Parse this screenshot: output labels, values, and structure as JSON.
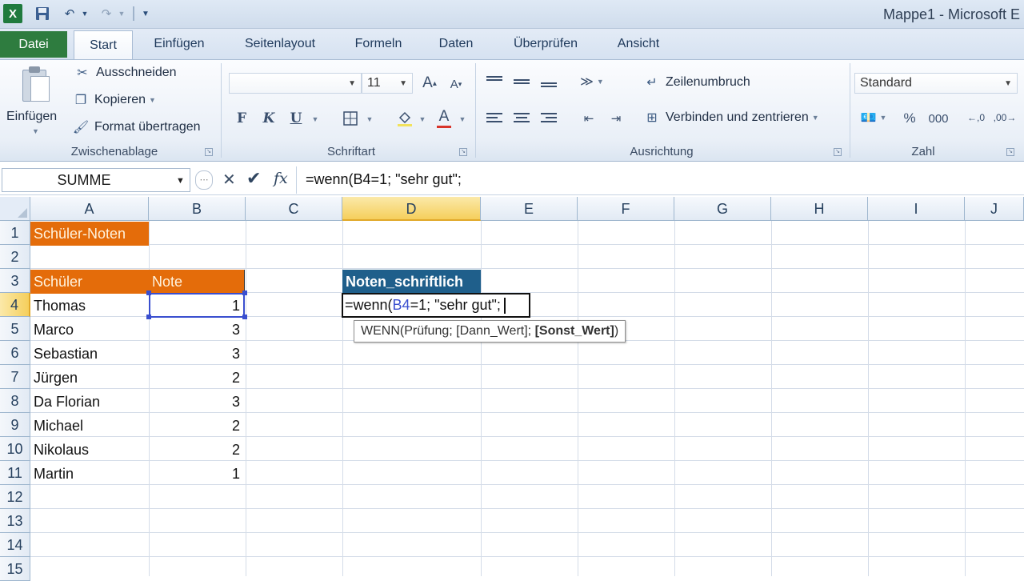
{
  "window": {
    "title": "Mappe1 - Microsoft E"
  },
  "quick_access": {
    "logo": "X",
    "save_icon": "save-icon",
    "undo_icon": "undo-icon",
    "redo_icon": "redo-icon"
  },
  "tabs": [
    "Datei",
    "Start",
    "Einfügen",
    "Seitenlayout",
    "Formeln",
    "Daten",
    "Überprüfen",
    "Ansicht"
  ],
  "ribbon": {
    "clipboard": {
      "paste": "Einfügen",
      "cut": "Ausschneiden",
      "copy": "Kopieren",
      "format_painter": "Format übertragen",
      "label": "Zwischenablage"
    },
    "font": {
      "name": "",
      "size": "11",
      "bold": "F",
      "italic": "K",
      "underline": "U",
      "label": "Schriftart"
    },
    "alignment": {
      "wrap": "Zeilenumbruch",
      "merge": "Verbinden und zentrieren",
      "label": "Ausrichtung"
    },
    "number": {
      "format": "Standard",
      "percent": "%",
      "thousands": "000",
      "label": "Zahl"
    }
  },
  "formula_bar": {
    "name_box": "SUMME",
    "formula": "=wenn(B4=1; \"sehr gut\";",
    "fx": "fx"
  },
  "columns": [
    "A",
    "B",
    "C",
    "D",
    "E",
    "F",
    "G",
    "H",
    "I",
    "J"
  ],
  "rows": [
    "1",
    "2",
    "3",
    "4",
    "5",
    "6",
    "7",
    "8",
    "9",
    "10",
    "11",
    "12",
    "13",
    "14",
    "15"
  ],
  "sheet": {
    "title": "Schüler-Noten",
    "header_student": "Schüler",
    "header_grade": "Note",
    "header_written": "Noten_schriftlich",
    "students": [
      {
        "name": "Thomas",
        "grade": "1"
      },
      {
        "name": "Marco",
        "grade": "3"
      },
      {
        "name": "Sebastian",
        "grade": "3"
      },
      {
        "name": "Jürgen",
        "grade": "2"
      },
      {
        "name": "Da Florian",
        "grade": "3"
      },
      {
        "name": "Michael",
        "grade": "2"
      },
      {
        "name": "Nikolaus",
        "grade": "2"
      },
      {
        "name": "Martin",
        "grade": "1"
      }
    ],
    "editing": {
      "prefix": "=wenn(",
      "ref": "B4",
      "suffix": "=1; \"sehr gut\";"
    },
    "tooltip": {
      "fn": "WENN(Prüfung; [Dann_Wert]; ",
      "bold_arg": "[Sonst_Wert]",
      "close": ")"
    }
  },
  "colors": {
    "orange_header": "#e46c0a",
    "blue_header": "#1f5f8b",
    "active_header": "#f5cf5c",
    "selection": "#3a4fcf"
  }
}
